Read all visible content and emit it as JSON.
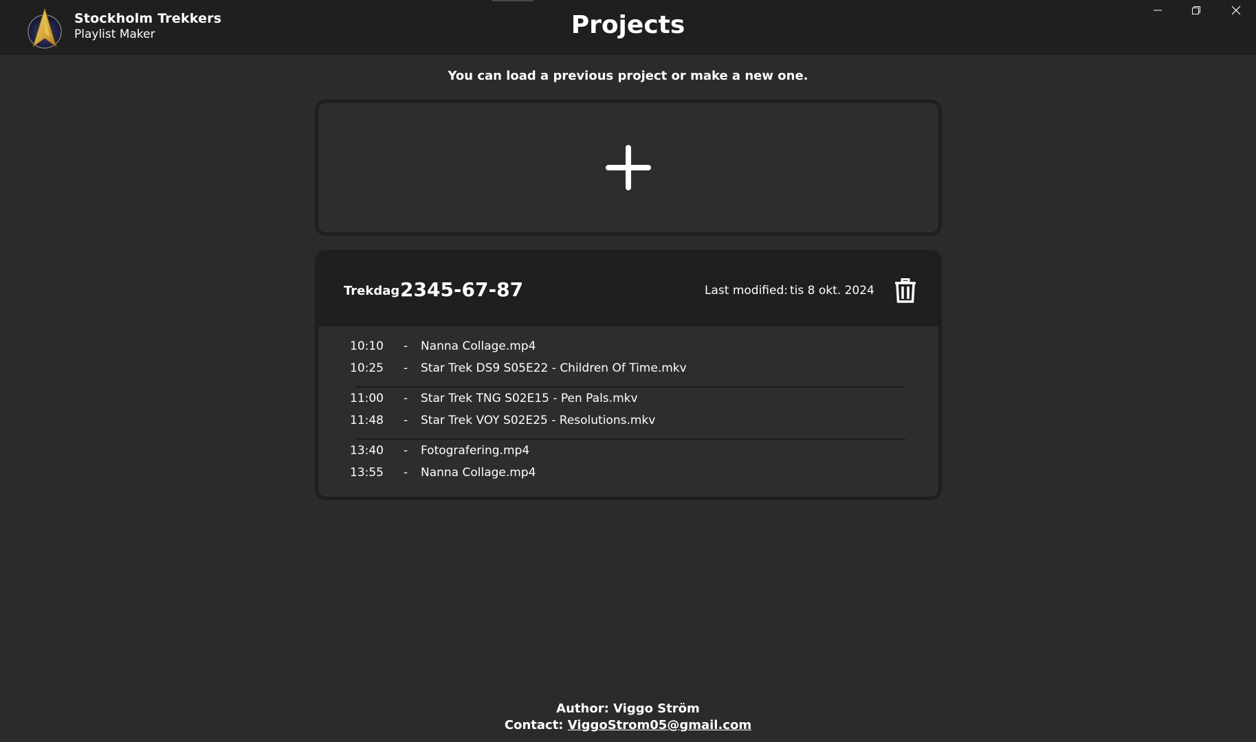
{
  "app": {
    "name": "Stockholm Trekkers",
    "subtitle": "Playlist Maker"
  },
  "page": {
    "title": "Projects",
    "instruction": "You can load a previous project or make a new one."
  },
  "icons": {
    "logo": "starfleet-delta-icon",
    "new_project": "plus-icon",
    "delete": "trash-icon",
    "minimize": "minimize-icon",
    "maximize": "restore-icon",
    "close": "close-icon"
  },
  "project": {
    "label": "Trekdag",
    "number": "2345-67-87",
    "modified_label": "Last modified:",
    "modified_value": "tis 8 okt. 2024",
    "groups": [
      {
        "items": [
          {
            "time": "10:10",
            "dash": "-",
            "file": "Nanna Collage.mp4"
          },
          {
            "time": "10:25",
            "dash": "-",
            "file": "Star Trek DS9 S05E22 - Children Of Time.mkv"
          }
        ]
      },
      {
        "items": [
          {
            "time": "11:00",
            "dash": "-",
            "file": "Star Trek TNG S02E15 - Pen Pals.mkv"
          },
          {
            "time": "11:48",
            "dash": "-",
            "file": "Star Trek VOY S02E25 - Resolutions.mkv"
          }
        ]
      },
      {
        "items": [
          {
            "time": "13:40",
            "dash": "-",
            "file": "Fotografering.mp4"
          },
          {
            "time": "13:55",
            "dash": "-",
            "file": "Nanna Collage.mp4"
          }
        ]
      }
    ]
  },
  "footer": {
    "author": "Author: Viggo Ström",
    "contact_label": "Contact:",
    "contact_email": "ViggoStrom05@gmail.com"
  },
  "colors": {
    "background": "#2b2b2b",
    "titlebar": "#1f1f1f",
    "card_border": "#1e1e1e",
    "text": "#ffffff"
  }
}
